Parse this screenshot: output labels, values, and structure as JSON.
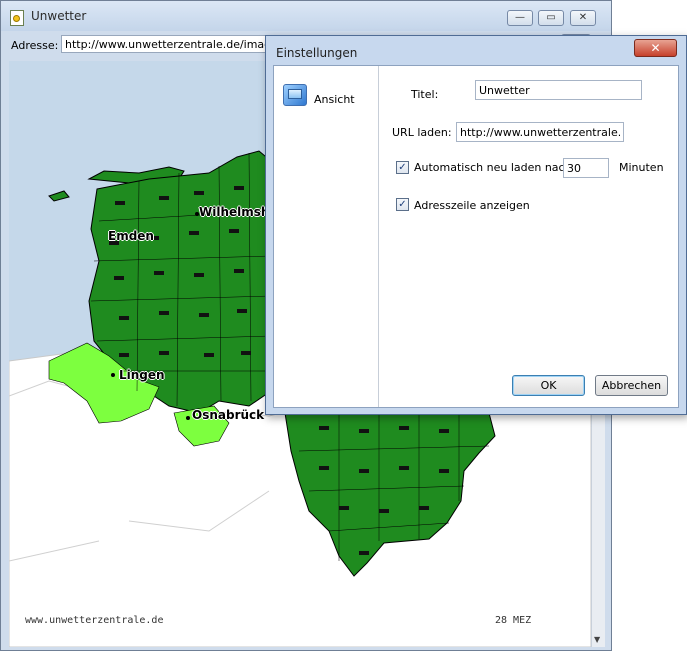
{
  "window": {
    "title": "Unwetter",
    "controls": {
      "minimize": "—",
      "maximize": "▭",
      "close": "✕"
    }
  },
  "address_bar": {
    "label": "Adresse:",
    "value": "http://www.unwetterzentrale.de/images/m"
  },
  "map": {
    "cities": [
      "Emden",
      "Wilhelmshav",
      "Lingen",
      "Osnabrück"
    ],
    "footer_left": "www.unwetterzentrale.de",
    "footer_right": "28 MEZ",
    "colors": {
      "sea": "#c5d8ea",
      "region_dark": "#1f8b1f",
      "region_light": "#7dff3f",
      "border": "#000000"
    }
  },
  "dialog": {
    "title": "Einstellungen",
    "close_symbol": "✕",
    "sidebar": {
      "items": [
        {
          "label": "Ansicht",
          "icon": "view-window-icon"
        }
      ]
    },
    "form": {
      "title_label": "Titel:",
      "title_value": "Unwetter",
      "url_label": "URL laden:",
      "url_value": "http://www.unwetterzentrale.de/ir",
      "auto_reload_label": "Automatisch neu laden nach",
      "auto_reload_checked": true,
      "reload_minutes": "30",
      "minutes_unit": "Minuten",
      "show_address_label": "Adresszeile anzeigen",
      "show_address_checked": true
    },
    "buttons": {
      "ok": "OK",
      "cancel": "Abbrechen"
    }
  }
}
